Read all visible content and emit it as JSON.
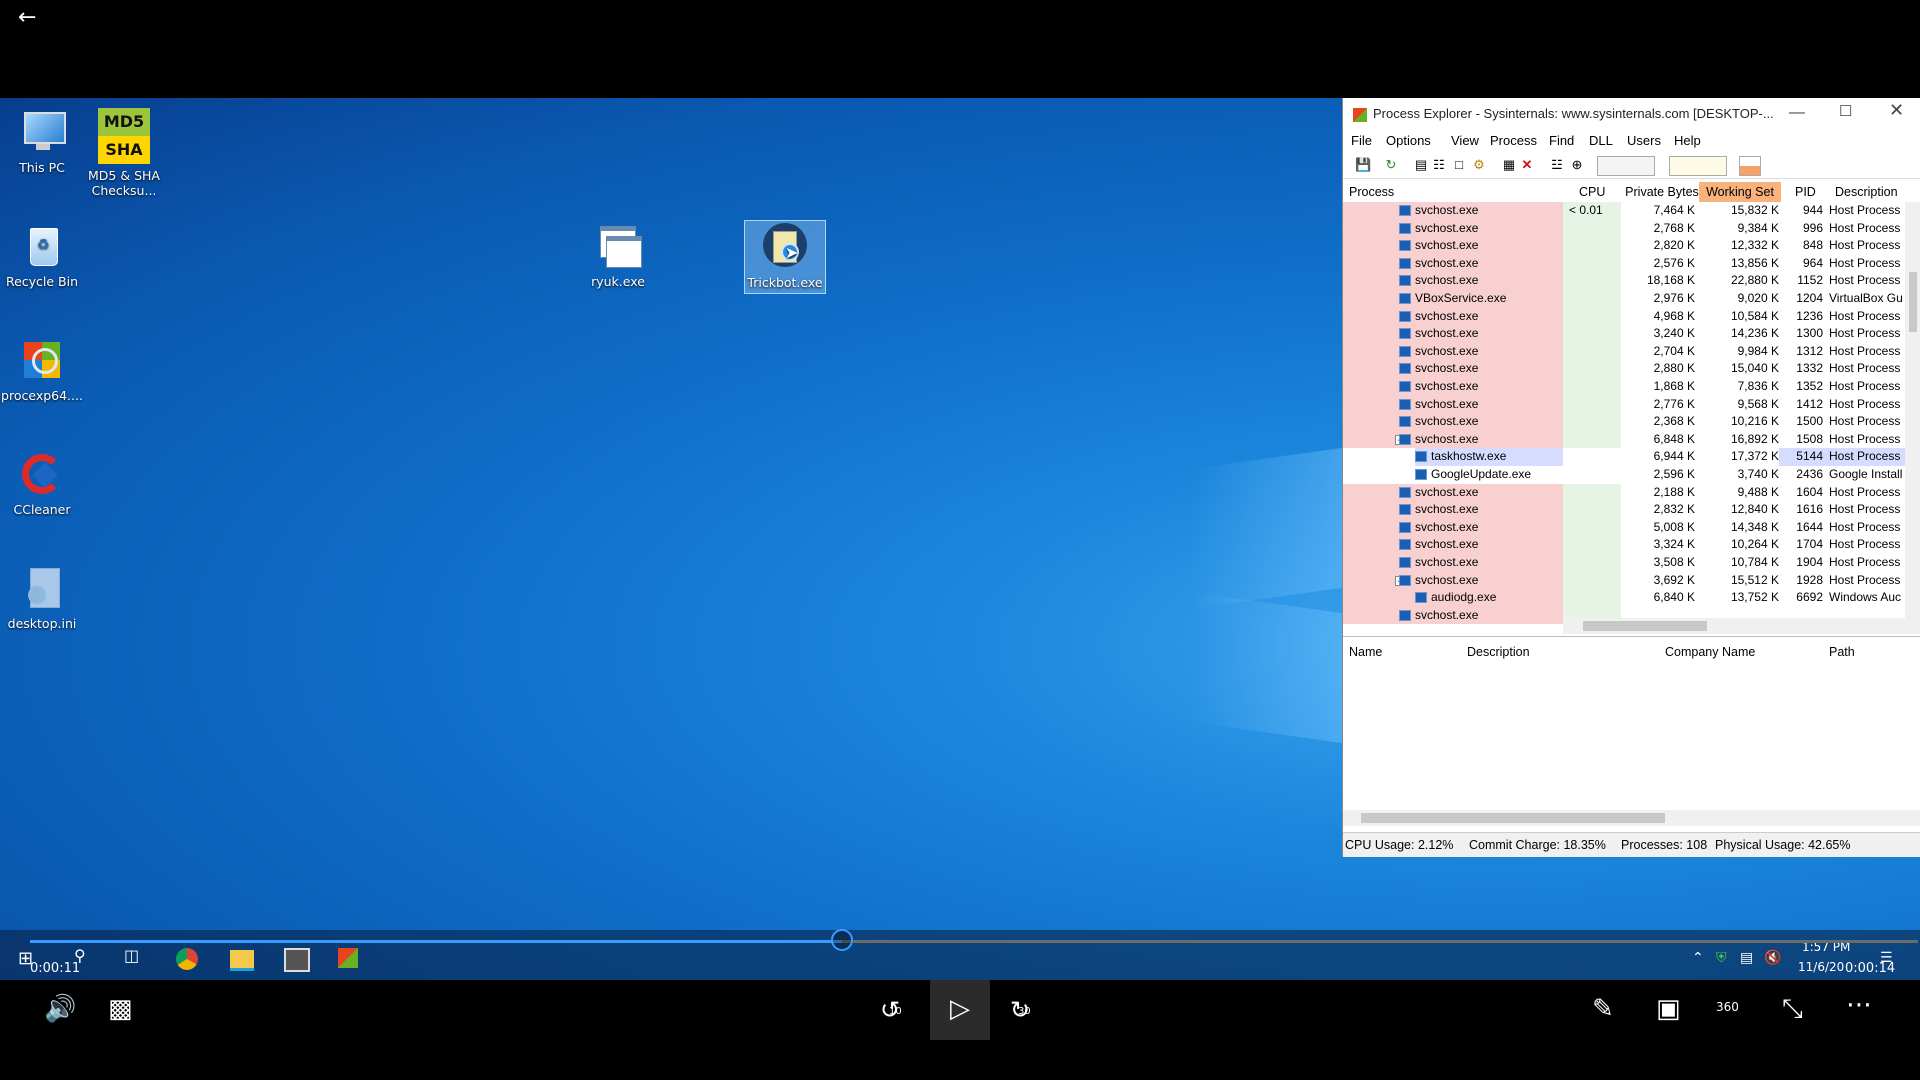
{
  "desktop_icons": [
    {
      "label": "This PC",
      "icon": "monitor-icon"
    },
    {
      "label": "MD5 & SHA Checksu...",
      "icon": "md5-sha-icon",
      "badge_top": "MD5",
      "badge_bottom": "SHA"
    },
    {
      "label": "Recycle Bin",
      "icon": "recycle-bin-icon"
    },
    {
      "label": "procexp64....",
      "icon": "procexp-icon"
    },
    {
      "label": "CCleaner",
      "icon": "ccleaner-icon"
    },
    {
      "label": "desktop.ini",
      "icon": "ini-file-icon"
    },
    {
      "label": "ryuk.exe",
      "icon": "exe-window-icon"
    },
    {
      "label": "Trickbot.exe",
      "icon": "trickbot-icon"
    }
  ],
  "process_explorer": {
    "title": "Process Explorer - Sysinternals: www.sysinternals.com [DESKTOP-...",
    "menu": [
      "File",
      "Options",
      "View",
      "Process",
      "Find",
      "DLL",
      "Users",
      "Help"
    ],
    "columns": [
      "Process",
      "CPU",
      "Private Bytes",
      "Working Set",
      "PID",
      "Description"
    ],
    "rows": [
      {
        "name": "svchost.exe",
        "cpu": "< 0.01",
        "pb": "7,464 K",
        "ws": "15,832 K",
        "pid": "944",
        "desc": "Host Process"
      },
      {
        "name": "svchost.exe",
        "cpu": "",
        "pb": "2,768 K",
        "ws": "9,384 K",
        "pid": "996",
        "desc": "Host Process"
      },
      {
        "name": "svchost.exe",
        "cpu": "",
        "pb": "2,820 K",
        "ws": "12,332 K",
        "pid": "848",
        "desc": "Host Process"
      },
      {
        "name": "svchost.exe",
        "cpu": "",
        "pb": "2,576 K",
        "ws": "13,856 K",
        "pid": "964",
        "desc": "Host Process"
      },
      {
        "name": "svchost.exe",
        "cpu": "",
        "pb": "18,168 K",
        "ws": "22,880 K",
        "pid": "1152",
        "desc": "Host Process"
      },
      {
        "name": "VBoxService.exe",
        "cpu": "",
        "pb": "2,976 K",
        "ws": "9,020 K",
        "pid": "1204",
        "desc": "VirtualBox Gu"
      },
      {
        "name": "svchost.exe",
        "cpu": "",
        "pb": "4,968 K",
        "ws": "10,584 K",
        "pid": "1236",
        "desc": "Host Process"
      },
      {
        "name": "svchost.exe",
        "cpu": "",
        "pb": "3,240 K",
        "ws": "14,236 K",
        "pid": "1300",
        "desc": "Host Process"
      },
      {
        "name": "svchost.exe",
        "cpu": "",
        "pb": "2,704 K",
        "ws": "9,984 K",
        "pid": "1312",
        "desc": "Host Process"
      },
      {
        "name": "svchost.exe",
        "cpu": "",
        "pb": "2,880 K",
        "ws": "15,040 K",
        "pid": "1332",
        "desc": "Host Process"
      },
      {
        "name": "svchost.exe",
        "cpu": "",
        "pb": "1,868 K",
        "ws": "7,836 K",
        "pid": "1352",
        "desc": "Host Process"
      },
      {
        "name": "svchost.exe",
        "cpu": "",
        "pb": "2,776 K",
        "ws": "9,568 K",
        "pid": "1412",
        "desc": "Host Process"
      },
      {
        "name": "svchost.exe",
        "cpu": "",
        "pb": "2,368 K",
        "ws": "10,216 K",
        "pid": "1500",
        "desc": "Host Process"
      },
      {
        "name": "svchost.exe",
        "cpu": "",
        "pb": "6,848 K",
        "ws": "16,892 K",
        "pid": "1508",
        "desc": "Host Process",
        "expanded": true
      },
      {
        "name": "taskhostw.exe",
        "cpu": "",
        "pb": "6,944 K",
        "ws": "17,372 K",
        "pid": "5144",
        "desc": "Host Process",
        "child": true,
        "selected": true
      },
      {
        "name": "GoogleUpdate.exe",
        "cpu": "",
        "pb": "2,596 K",
        "ws": "3,740 K",
        "pid": "2436",
        "desc": "Google Install",
        "child": true,
        "plain": true
      },
      {
        "name": "svchost.exe",
        "cpu": "",
        "pb": "2,188 K",
        "ws": "9,488 K",
        "pid": "1604",
        "desc": "Host Process"
      },
      {
        "name": "svchost.exe",
        "cpu": "",
        "pb": "2,832 K",
        "ws": "12,840 K",
        "pid": "1616",
        "desc": "Host Process"
      },
      {
        "name": "svchost.exe",
        "cpu": "",
        "pb": "5,008 K",
        "ws": "14,348 K",
        "pid": "1644",
        "desc": "Host Process"
      },
      {
        "name": "svchost.exe",
        "cpu": "",
        "pb": "3,324 K",
        "ws": "10,264 K",
        "pid": "1704",
        "desc": "Host Process"
      },
      {
        "name": "svchost.exe",
        "cpu": "",
        "pb": "3,508 K",
        "ws": "10,784 K",
        "pid": "1904",
        "desc": "Host Process"
      },
      {
        "name": "svchost.exe",
        "cpu": "",
        "pb": "3,692 K",
        "ws": "15,512 K",
        "pid": "1928",
        "desc": "Host Process",
        "expanded": true
      },
      {
        "name": "audiodg.exe",
        "cpu": "",
        "pb": "6,840 K",
        "ws": "13,752 K",
        "pid": "6692",
        "desc": "Windows Auc",
        "child": true
      },
      {
        "name": "svchost.exe",
        "cpu": "",
        "pb": "",
        "ws": "",
        "pid": "",
        "desc": ""
      }
    ],
    "lower_columns": [
      "Name",
      "Description",
      "Company Name",
      "Path"
    ],
    "status": {
      "cpu": "CPU Usage: 2.12%",
      "commit": "Commit Charge: 18.35%",
      "processes": "Processes: 108",
      "physical": "Physical Usage: 42.65%"
    }
  },
  "taskbar": {
    "clock_time": "1:57 PM",
    "clock_date": "11/6/20"
  },
  "player": {
    "elapsed": "0:00:11",
    "remaining": "0:00:14",
    "progress": 0.43,
    "skip_back_label": "10",
    "skip_fwd_label": "30",
    "vr_label": "360"
  },
  "colors": {
    "accent": "#3a9bff",
    "process_highlight": "#f8d0d0",
    "cpu_column": "#e6f4e6",
    "selected_row": "#d5dcff"
  }
}
